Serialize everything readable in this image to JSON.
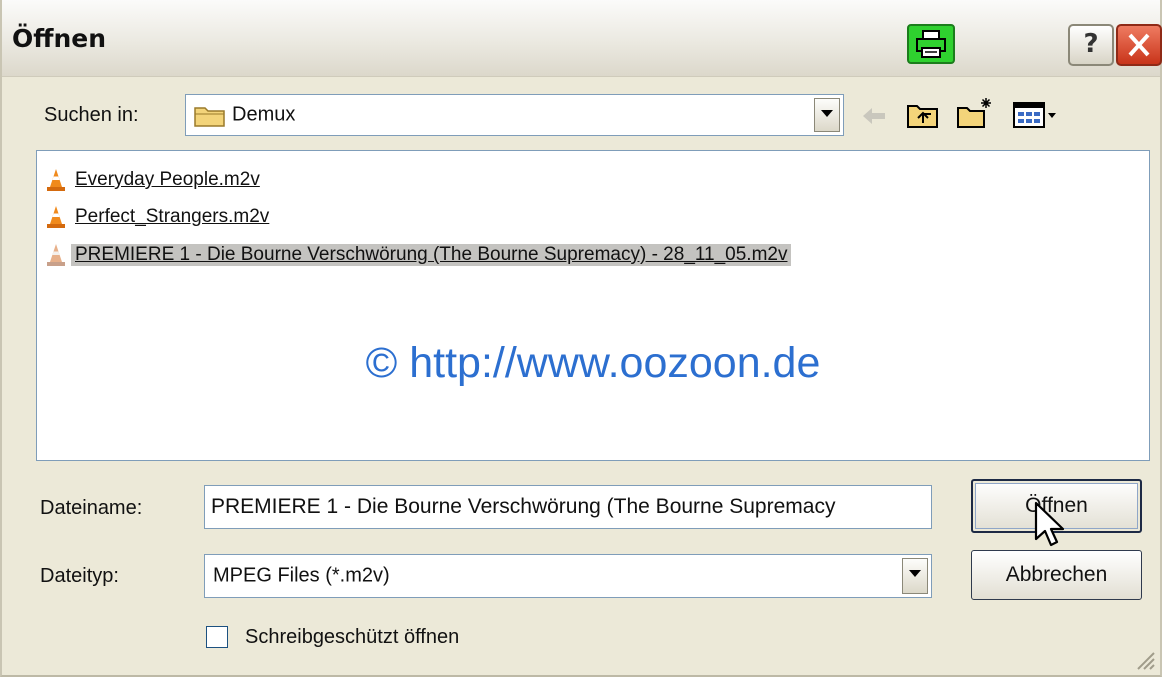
{
  "window": {
    "title": "Öffnen",
    "help_glyph": "?"
  },
  "look_in": {
    "label": "Suchen in:",
    "value": "Demux"
  },
  "files": [
    {
      "name": "Everyday People.m2v",
      "selected": false
    },
    {
      "name": "Perfect_Strangers.m2v",
      "selected": false
    },
    {
      "name": "PREMIERE 1 - Die Bourne Verschwörung (The Bourne Supremacy) - 28_11_05.m2v",
      "selected": true
    }
  ],
  "watermark": "© http://www.oozoon.de",
  "filename": {
    "label": "Dateiname:",
    "value": "PREMIERE 1 - Die Bourne Verschwörung (The Bourne Supremacy"
  },
  "filetype": {
    "label": "Dateityp:",
    "value": "MPEG Files (*.m2v)"
  },
  "readonly": {
    "label": "Schreibgeschützt öffnen",
    "checked": false
  },
  "buttons": {
    "open": "Öffnen",
    "cancel": "Abbrechen"
  },
  "icons": {
    "toolbar": [
      "back-arrow-icon",
      "up-folder-icon",
      "new-folder-icon",
      "view-menu-icon"
    ],
    "file": "vlc-cone-icon",
    "folder": "folder-icon",
    "printer": "printer-icon"
  },
  "colors": {
    "accent": "#2c6fd0",
    "selection": "#c4c3c0",
    "close_button": "#c8341a",
    "printer_button": "#2fd12f"
  }
}
